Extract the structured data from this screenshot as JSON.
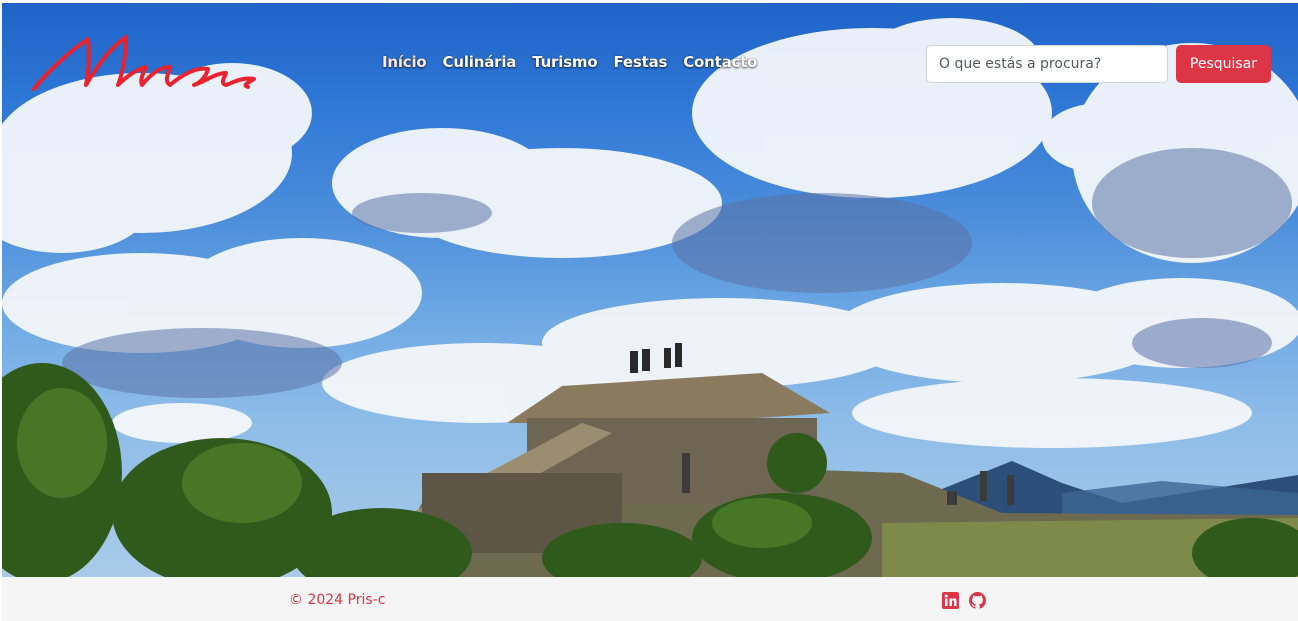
{
  "brand": {
    "logo_text": "Minas",
    "logo_color": "#e8222f"
  },
  "nav": {
    "items": [
      {
        "label": "Início",
        "active": true
      },
      {
        "label": "Culinária",
        "active": false
      },
      {
        "label": "Turismo",
        "active": false
      },
      {
        "label": "Festas",
        "active": false
      },
      {
        "label": "Contacto",
        "active": false
      }
    ]
  },
  "search": {
    "placeholder": "O que estás a procura?",
    "value": "",
    "button_label": "Pesquisar"
  },
  "colors": {
    "accent": "#dc3545",
    "footer_bg": "#f5f5f5"
  },
  "footer": {
    "copyright": "© 2024 Pris-c",
    "social": [
      {
        "icon": "linkedin-icon"
      },
      {
        "icon": "github-icon"
      }
    ]
  }
}
